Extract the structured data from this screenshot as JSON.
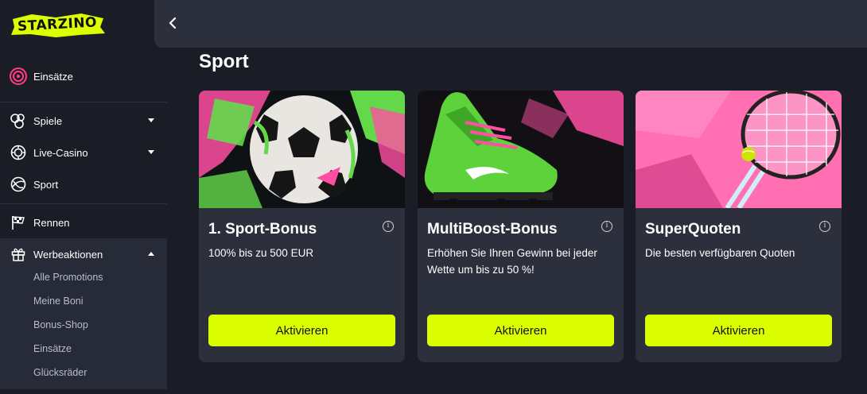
{
  "brand": {
    "logo_text": "STARZINO",
    "accent": "#dcff00",
    "logo_color": "#dcff00"
  },
  "sidebar": {
    "items": [
      {
        "label": "Einsätze",
        "icon": "target-icon"
      },
      {
        "label": "Spiele",
        "icon": "dice-icon",
        "expandable": true
      },
      {
        "label": "Live-Casino",
        "icon": "chip-icon",
        "expandable": true
      },
      {
        "label": "Sport",
        "icon": "ball-icon"
      },
      {
        "label": "Rennen",
        "icon": "checkered-flag-icon"
      },
      {
        "label": "Werbeaktionen",
        "icon": "gift-icon",
        "expanded": true
      }
    ],
    "submenu": [
      "Alle Promotions",
      "Meine Boni",
      "Bonus-Shop",
      "Einsätze",
      "Glücksräder"
    ]
  },
  "topbar": {
    "back_icon": "chevron-left-icon"
  },
  "main": {
    "section_title": "Sport",
    "cards": [
      {
        "title": "1. Sport-Bonus",
        "description": "100% bis zu 500 EUR",
        "button": "Aktivieren",
        "image": "soccer-ball-illustration"
      },
      {
        "title": "MultiBoost-Bonus",
        "description": "Erhöhen Sie Ihren Gewinn bei jeder Wette um bis zu 50 %!",
        "button": "Aktivieren",
        "image": "green-football-boot-illustration"
      },
      {
        "title": "SuperQuoten",
        "description": "Die besten verfügbaren Quoten",
        "button": "Aktivieren",
        "image": "tennis-racket-illustration"
      }
    ]
  }
}
